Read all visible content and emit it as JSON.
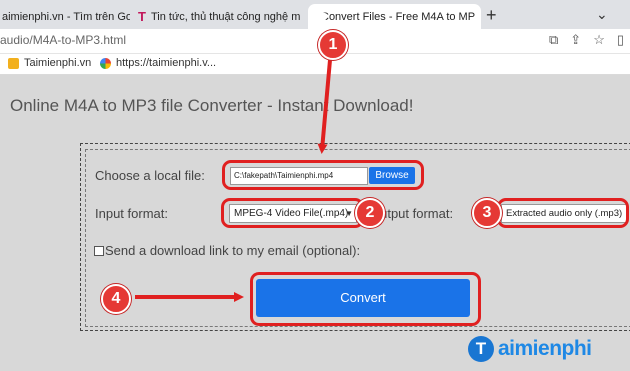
{
  "browser": {
    "tabs": [
      {
        "label": "aimienphi.vn - Tìm trên Google",
        "favicon": "google-icon"
      },
      {
        "label": "Tin tức, thủ thuật công nghệ m",
        "favicon": "taimienphi-icon"
      },
      {
        "label": "Convert Files - Free M4A to MP",
        "favicon": "convertfiles-icon",
        "active": true
      }
    ],
    "new_tab": "+",
    "url": "audio/M4A-to-MP3.html",
    "bookmarks": [
      {
        "label": "Taimienphi.vn"
      },
      {
        "label": "https://taimienphi.v..."
      }
    ]
  },
  "page": {
    "headline": "Online M4A to MP3 file Converter - Instant Download!",
    "file": {
      "label": "Choose a local file:",
      "value": "C:\\fakepath\\Taimienphi.mp4",
      "browse": "Browse"
    },
    "input_format": {
      "label": "Input format:",
      "value": "MPEG-4 Video File(.mp4)"
    },
    "output_format": {
      "label": "Output format:",
      "value": "Extracted audio only (.mp3)"
    },
    "email_option": {
      "label": "Send a download link to my email (optional):"
    },
    "convert": "Convert"
  },
  "annotations": {
    "steps": [
      "1",
      "2",
      "3",
      "4"
    ],
    "highlight_color": "#e02020"
  },
  "logo": {
    "text": "aimienphi"
  }
}
